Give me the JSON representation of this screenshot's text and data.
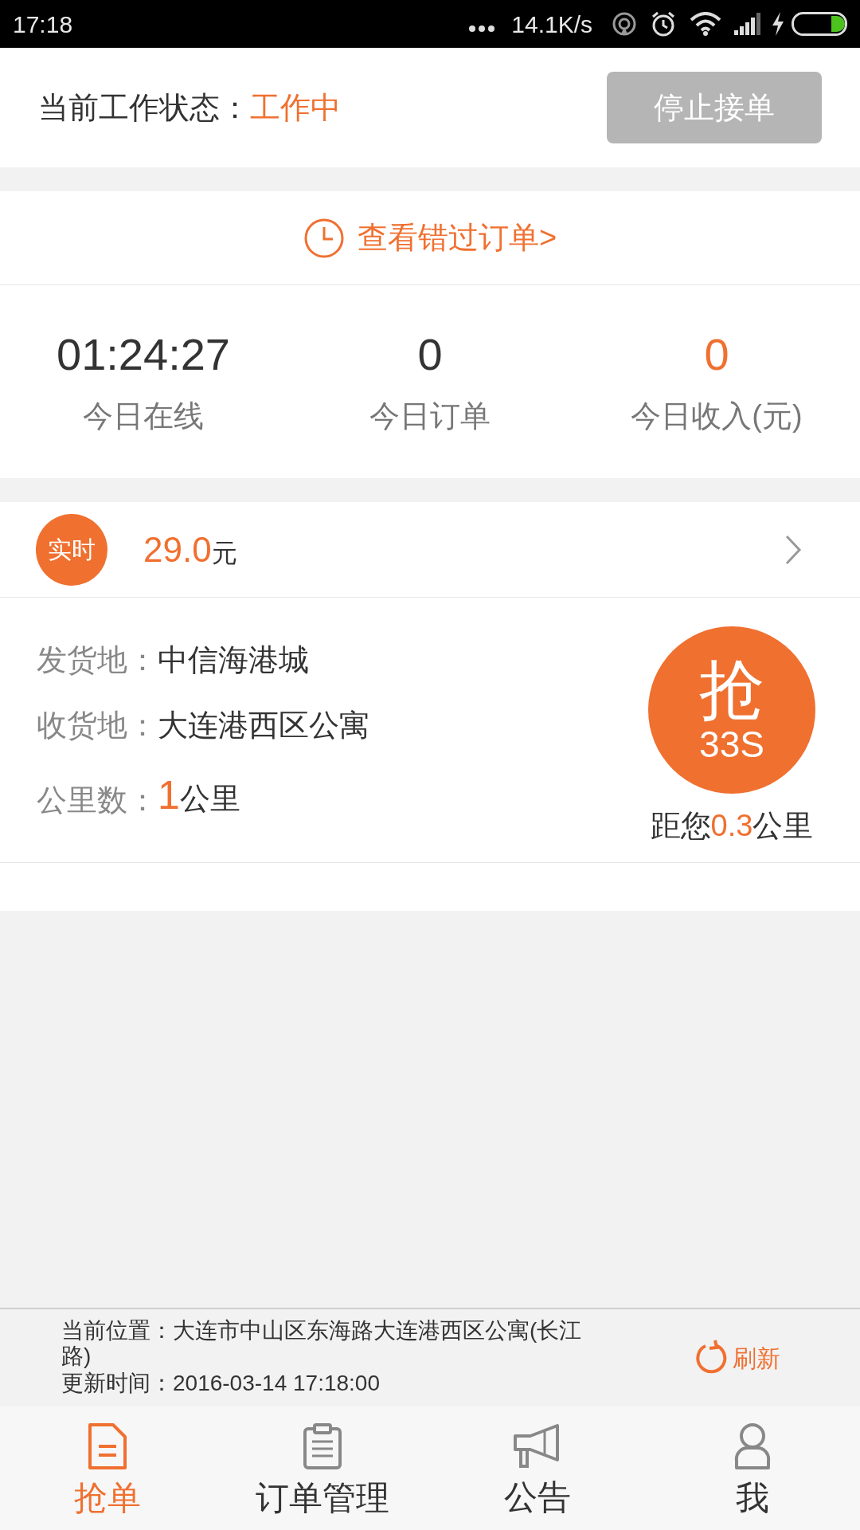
{
  "status_bar": {
    "time": "17:18",
    "net_speed": "14.1K/s"
  },
  "header": {
    "label": "当前工作状态：",
    "status": "工作中",
    "button": "停止接单"
  },
  "missed_orders_link": "查看错过订单>",
  "stats": [
    {
      "value": "01:24:27",
      "label": "今日在线",
      "highlighted": false
    },
    {
      "value": "0",
      "label": "今日订单",
      "highlighted": false
    },
    {
      "value": "0",
      "label": "今日收入(元)",
      "highlighted": true
    }
  ],
  "order": {
    "badge": "实时",
    "price": "29.0",
    "unit": "元",
    "details": [
      {
        "kind": "place",
        "label": "发货地：",
        "value": "中信海港城"
      },
      {
        "kind": "place",
        "label": "收货地：",
        "value": "大连港西区公寓"
      },
      {
        "kind": "distance",
        "label": "公里数：",
        "value": "1",
        "unit": "公里"
      }
    ],
    "grab": {
      "label": "抢",
      "countdown": "33S"
    },
    "distance": {
      "prefix": "距您",
      "value": "0.3",
      "unit": "公里"
    }
  },
  "location": {
    "address": "当前位置：大连市中山区东海路大连港西区公寓(长江路)",
    "updated": "更新时间：2016-03-14 17:18:00",
    "refresh": "刷新"
  },
  "tabs": [
    {
      "kind": "grab",
      "label": "抢单",
      "selected": true
    },
    {
      "kind": "orders",
      "label": "订单管理",
      "selected": false
    },
    {
      "kind": "notice",
      "label": "公告",
      "selected": false
    },
    {
      "kind": "me",
      "label": "我",
      "selected": false
    }
  ]
}
